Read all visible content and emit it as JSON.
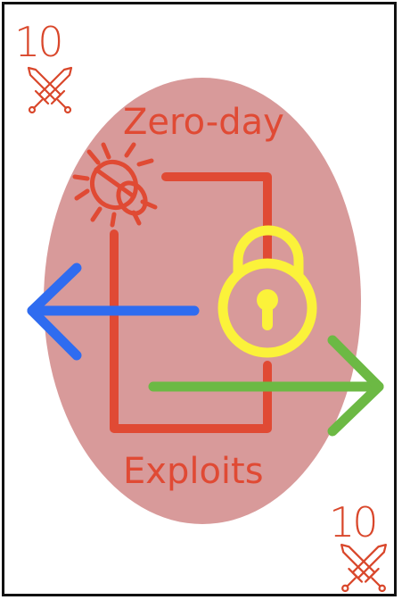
{
  "card": {
    "rank_top": "10",
    "rank_bottom": "10",
    "suit_icon": "crossed-swords-icon",
    "title": "Zero-day",
    "subtitle": "Exploits"
  },
  "colors": {
    "border": "#111111",
    "background": "#ffffff",
    "rank_text": "#d9472b",
    "oval": "#d89a9a",
    "path_red": "#e04a34",
    "bug": "#e04a34",
    "lock": "#fbf23a",
    "arrow_left": "#2f6cf0",
    "arrow_right": "#6cb944"
  }
}
